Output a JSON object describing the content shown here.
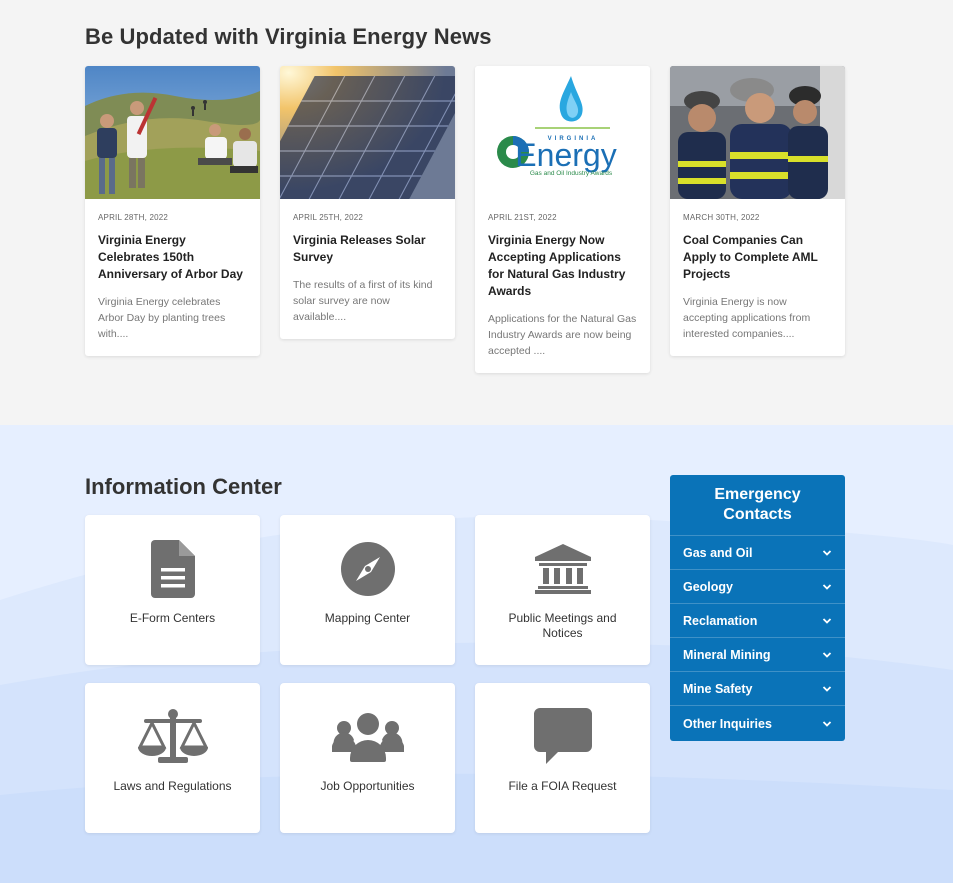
{
  "news": {
    "heading": "Be Updated with Virginia Energy News",
    "articles": [
      {
        "date": "APRIL 28TH, 2022",
        "title": "Virginia Energy Celebrates 150th Anniversary of Arbor Day",
        "excerpt": "Virginia Energy celebrates Arbor Day by planting trees with....",
        "image": "students-planting-trees-photo"
      },
      {
        "date": "APRIL 25TH, 2022",
        "title": " Virginia Releases Solar Survey",
        "excerpt": "The results of a first of its kind solar survey are now available....",
        "image": "solar-panels-photo"
      },
      {
        "date": "APRIL 21ST, 2022",
        "title": " Virginia Energy Now Accepting Applications for Natural Gas Industry Awards",
        "excerpt": "Applications for the Natural Gas Industry Awards are now being accepted  ....",
        "image": "virginia-energy-awards-logo",
        "logo": {
          "top": "VIRGINIA",
          "word": "Energy",
          "sub": "Gas and Oil Industry Awards"
        }
      },
      {
        "date": "MARCH 30TH, 2022",
        "title": " Coal Companies Can Apply to Complete AML Projects",
        "excerpt": "Virginia Energy is now accepting applications from interested companies....",
        "image": "coal-miners-photo"
      }
    ]
  },
  "info_center": {
    "heading": "Information Center",
    "tiles": [
      {
        "label": "E-Form Centers",
        "icon": "document-icon"
      },
      {
        "label": "Mapping Center",
        "icon": "compass-icon"
      },
      {
        "label": "Public Meetings and Notices",
        "icon": "building-columns-icon"
      },
      {
        "label": "Laws and Regulations",
        "icon": "scales-icon"
      },
      {
        "label": "Job Opportunities",
        "icon": "people-group-icon"
      },
      {
        "label": "File a FOIA Request",
        "icon": "speech-bubble-icon"
      }
    ]
  },
  "emergency": {
    "heading": "Emergency Contacts",
    "items": [
      {
        "label": "Gas and Oil"
      },
      {
        "label": "Geology"
      },
      {
        "label": "Reclamation"
      },
      {
        "label": "Mineral Mining"
      },
      {
        "label": "Mine Safety"
      },
      {
        "label": "Other Inquiries"
      }
    ]
  },
  "colors": {
    "emergency_bg": "#0a73b8",
    "icon_gray": "#6f6f6f",
    "info_bg": "#e6efff"
  }
}
